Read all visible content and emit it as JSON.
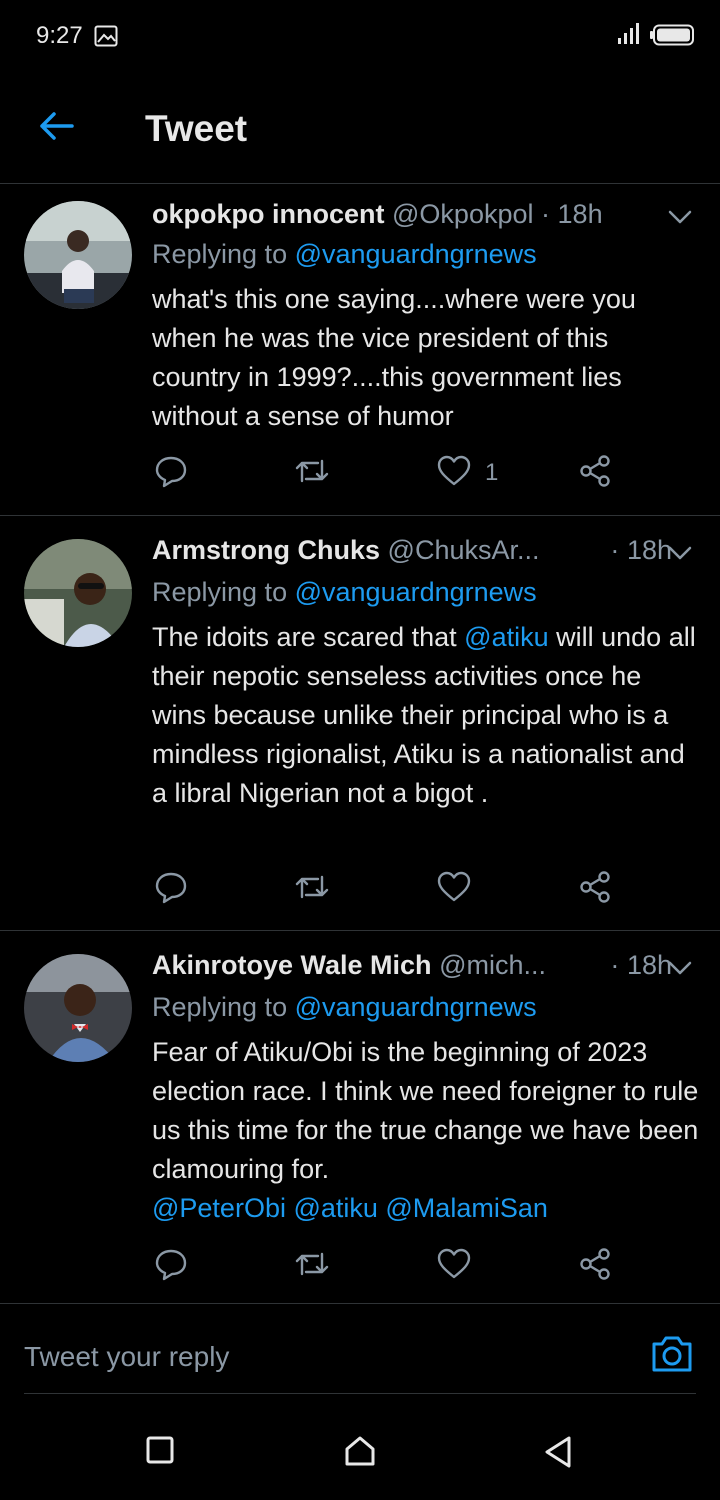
{
  "status_bar": {
    "time": "9:27"
  },
  "header": {
    "title": "Tweet"
  },
  "tweets": [
    {
      "name": "okpokpo innocent",
      "handle": "@Okpokpol",
      "separator": "·",
      "time": "18h",
      "replying_label": "Replying to",
      "replying_to": "@vanguardngrnews",
      "text": "what's this one saying....where were you when he was the vice president of this country in 1999?....this government lies without a sense of humor",
      "likes": "1"
    },
    {
      "name": "Armstrong Chuks",
      "handle": "@ChuksAr...",
      "separator": "·",
      "time": "18h",
      "replying_label": "Replying to",
      "replying_to": "@vanguardngrnews",
      "text_before": "The idoits are scared that ",
      "text_mention": "@atiku",
      "text_after": " will undo all their nepotic senseless activities once he wins because unlike their principal who is a mindless rigionalist, Atiku is a nationalist and a libral Nigerian not a bigot .",
      "likes": ""
    },
    {
      "name": "Akinrotoye Wale Mich",
      "handle": "@mich...",
      "separator": "·",
      "time": "18h",
      "replying_label": "Replying to",
      "replying_to": "@vanguardngrnews",
      "text": "Fear of Atiku/Obi is the beginning of 2023 election race. I think we need foreigner to rule us this time for the true change we have been clamouring for.",
      "mentions": "@PeterObi @atiku @MalamiSan",
      "likes": ""
    }
  ],
  "reply": {
    "placeholder": "Tweet your reply"
  },
  "colors": {
    "accent": "#1d9bf0",
    "muted": "#8b98a5",
    "background": "#000000"
  }
}
